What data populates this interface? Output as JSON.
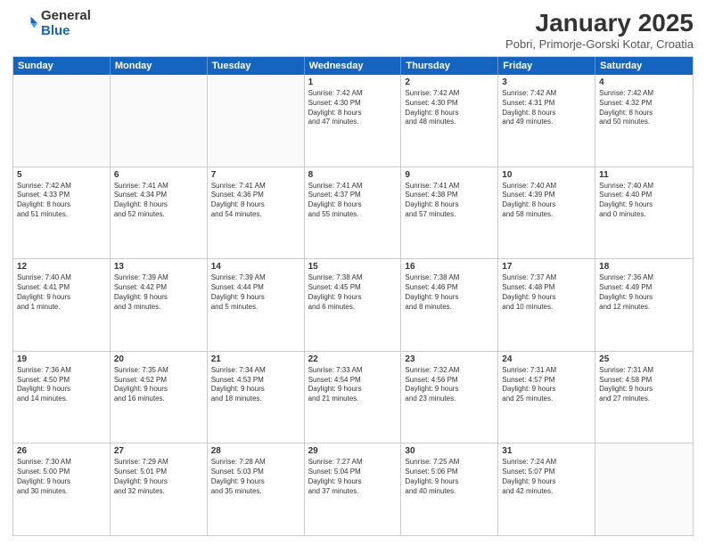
{
  "header": {
    "logo_general": "General",
    "logo_blue": "Blue",
    "month_title": "January 2025",
    "subtitle": "Pobri, Primorje-Gorski Kotar, Croatia"
  },
  "days_of_week": [
    "Sunday",
    "Monday",
    "Tuesday",
    "Wednesday",
    "Thursday",
    "Friday",
    "Saturday"
  ],
  "weeks": [
    [
      {
        "day": "",
        "lines": []
      },
      {
        "day": "",
        "lines": []
      },
      {
        "day": "",
        "lines": []
      },
      {
        "day": "1",
        "lines": [
          "Sunrise: 7:42 AM",
          "Sunset: 4:30 PM",
          "Daylight: 8 hours",
          "and 47 minutes."
        ]
      },
      {
        "day": "2",
        "lines": [
          "Sunrise: 7:42 AM",
          "Sunset: 4:30 PM",
          "Daylight: 8 hours",
          "and 48 minutes."
        ]
      },
      {
        "day": "3",
        "lines": [
          "Sunrise: 7:42 AM",
          "Sunset: 4:31 PM",
          "Daylight: 8 hours",
          "and 49 minutes."
        ]
      },
      {
        "day": "4",
        "lines": [
          "Sunrise: 7:42 AM",
          "Sunset: 4:32 PM",
          "Daylight: 8 hours",
          "and 50 minutes."
        ]
      }
    ],
    [
      {
        "day": "5",
        "lines": [
          "Sunrise: 7:42 AM",
          "Sunset: 4:33 PM",
          "Daylight: 8 hours",
          "and 51 minutes."
        ]
      },
      {
        "day": "6",
        "lines": [
          "Sunrise: 7:41 AM",
          "Sunset: 4:34 PM",
          "Daylight: 8 hours",
          "and 52 minutes."
        ]
      },
      {
        "day": "7",
        "lines": [
          "Sunrise: 7:41 AM",
          "Sunset: 4:36 PM",
          "Daylight: 8 hours",
          "and 54 minutes."
        ]
      },
      {
        "day": "8",
        "lines": [
          "Sunrise: 7:41 AM",
          "Sunset: 4:37 PM",
          "Daylight: 8 hours",
          "and 55 minutes."
        ]
      },
      {
        "day": "9",
        "lines": [
          "Sunrise: 7:41 AM",
          "Sunset: 4:38 PM",
          "Daylight: 8 hours",
          "and 57 minutes."
        ]
      },
      {
        "day": "10",
        "lines": [
          "Sunrise: 7:40 AM",
          "Sunset: 4:39 PM",
          "Daylight: 8 hours",
          "and 58 minutes."
        ]
      },
      {
        "day": "11",
        "lines": [
          "Sunrise: 7:40 AM",
          "Sunset: 4:40 PM",
          "Daylight: 9 hours",
          "and 0 minutes."
        ]
      }
    ],
    [
      {
        "day": "12",
        "lines": [
          "Sunrise: 7:40 AM",
          "Sunset: 4:41 PM",
          "Daylight: 9 hours",
          "and 1 minute."
        ]
      },
      {
        "day": "13",
        "lines": [
          "Sunrise: 7:39 AM",
          "Sunset: 4:42 PM",
          "Daylight: 9 hours",
          "and 3 minutes."
        ]
      },
      {
        "day": "14",
        "lines": [
          "Sunrise: 7:39 AM",
          "Sunset: 4:44 PM",
          "Daylight: 9 hours",
          "and 5 minutes."
        ]
      },
      {
        "day": "15",
        "lines": [
          "Sunrise: 7:38 AM",
          "Sunset: 4:45 PM",
          "Daylight: 9 hours",
          "and 6 minutes."
        ]
      },
      {
        "day": "16",
        "lines": [
          "Sunrise: 7:38 AM",
          "Sunset: 4:46 PM",
          "Daylight: 9 hours",
          "and 8 minutes."
        ]
      },
      {
        "day": "17",
        "lines": [
          "Sunrise: 7:37 AM",
          "Sunset: 4:48 PM",
          "Daylight: 9 hours",
          "and 10 minutes."
        ]
      },
      {
        "day": "18",
        "lines": [
          "Sunrise: 7:36 AM",
          "Sunset: 4:49 PM",
          "Daylight: 9 hours",
          "and 12 minutes."
        ]
      }
    ],
    [
      {
        "day": "19",
        "lines": [
          "Sunrise: 7:36 AM",
          "Sunset: 4:50 PM",
          "Daylight: 9 hours",
          "and 14 minutes."
        ]
      },
      {
        "day": "20",
        "lines": [
          "Sunrise: 7:35 AM",
          "Sunset: 4:52 PM",
          "Daylight: 9 hours",
          "and 16 minutes."
        ]
      },
      {
        "day": "21",
        "lines": [
          "Sunrise: 7:34 AM",
          "Sunset: 4:53 PM",
          "Daylight: 9 hours",
          "and 18 minutes."
        ]
      },
      {
        "day": "22",
        "lines": [
          "Sunrise: 7:33 AM",
          "Sunset: 4:54 PM",
          "Daylight: 9 hours",
          "and 21 minutes."
        ]
      },
      {
        "day": "23",
        "lines": [
          "Sunrise: 7:32 AM",
          "Sunset: 4:56 PM",
          "Daylight: 9 hours",
          "and 23 minutes."
        ]
      },
      {
        "day": "24",
        "lines": [
          "Sunrise: 7:31 AM",
          "Sunset: 4:57 PM",
          "Daylight: 9 hours",
          "and 25 minutes."
        ]
      },
      {
        "day": "25",
        "lines": [
          "Sunrise: 7:31 AM",
          "Sunset: 4:58 PM",
          "Daylight: 9 hours",
          "and 27 minutes."
        ]
      }
    ],
    [
      {
        "day": "26",
        "lines": [
          "Sunrise: 7:30 AM",
          "Sunset: 5:00 PM",
          "Daylight: 9 hours",
          "and 30 minutes."
        ]
      },
      {
        "day": "27",
        "lines": [
          "Sunrise: 7:29 AM",
          "Sunset: 5:01 PM",
          "Daylight: 9 hours",
          "and 32 minutes."
        ]
      },
      {
        "day": "28",
        "lines": [
          "Sunrise: 7:28 AM",
          "Sunset: 5:03 PM",
          "Daylight: 9 hours",
          "and 35 minutes."
        ]
      },
      {
        "day": "29",
        "lines": [
          "Sunrise: 7:27 AM",
          "Sunset: 5:04 PM",
          "Daylight: 9 hours",
          "and 37 minutes."
        ]
      },
      {
        "day": "30",
        "lines": [
          "Sunrise: 7:25 AM",
          "Sunset: 5:06 PM",
          "Daylight: 9 hours",
          "and 40 minutes."
        ]
      },
      {
        "day": "31",
        "lines": [
          "Sunrise: 7:24 AM",
          "Sunset: 5:07 PM",
          "Daylight: 9 hours",
          "and 42 minutes."
        ]
      },
      {
        "day": "",
        "lines": []
      }
    ]
  ]
}
